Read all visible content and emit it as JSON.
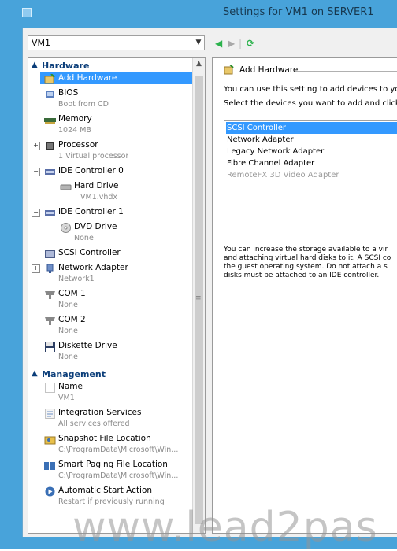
{
  "window": {
    "title": "Settings for VM1 on SERVER1"
  },
  "vm_selector": {
    "value": "VM1"
  },
  "tree": {
    "sections": [
      {
        "label": "Hardware"
      },
      {
        "label": "Management"
      }
    ],
    "hardware_items": [
      {
        "label": "Add Hardware",
        "sub": "",
        "selected": true
      },
      {
        "label": "BIOS",
        "sub": "Boot from CD"
      },
      {
        "label": "Memory",
        "sub": "1024 MB"
      },
      {
        "label": "Processor",
        "sub": "1 Virtual processor"
      },
      {
        "label": "IDE Controller 0",
        "sub": ""
      },
      {
        "label": "Hard Drive",
        "sub": "VM1.vhdx"
      },
      {
        "label": "IDE Controller 1",
        "sub": ""
      },
      {
        "label": "DVD Drive",
        "sub": "None"
      },
      {
        "label": "SCSI Controller",
        "sub": ""
      },
      {
        "label": "Network Adapter",
        "sub": "Network1"
      },
      {
        "label": "COM 1",
        "sub": "None"
      },
      {
        "label": "COM 2",
        "sub": "None"
      },
      {
        "label": "Diskette Drive",
        "sub": "None"
      }
    ],
    "management_items": [
      {
        "label": "Name",
        "sub": "VM1"
      },
      {
        "label": "Integration Services",
        "sub": "All services offered"
      },
      {
        "label": "Snapshot File Location",
        "sub": "C:\\ProgramData\\Microsoft\\Win..."
      },
      {
        "label": "Smart Paging File Location",
        "sub": "C:\\ProgramData\\Microsoft\\Win..."
      },
      {
        "label": "Automatic Start Action",
        "sub": "Restart if previously running"
      }
    ]
  },
  "details": {
    "title": "Add Hardware",
    "intro": "You can use this setting to add devices to your",
    "select_prompt": "Select the devices you want to add and click th",
    "devices": [
      {
        "label": "SCSI Controller",
        "selected": true,
        "disabled": false
      },
      {
        "label": "Network Adapter",
        "selected": false,
        "disabled": false
      },
      {
        "label": "Legacy Network Adapter",
        "selected": false,
        "disabled": false
      },
      {
        "label": "Fibre Channel Adapter",
        "selected": false,
        "disabled": false
      },
      {
        "label": "RemoteFX 3D Video Adapter",
        "selected": false,
        "disabled": true
      }
    ],
    "description": [
      "You can increase the storage available to a vir",
      "and attaching virtual hard disks to it. A SCSI co",
      "the guest operating system. Do not attach a s",
      "disks must be attached to an IDE controller."
    ]
  },
  "watermark": "www.lead2pas"
}
